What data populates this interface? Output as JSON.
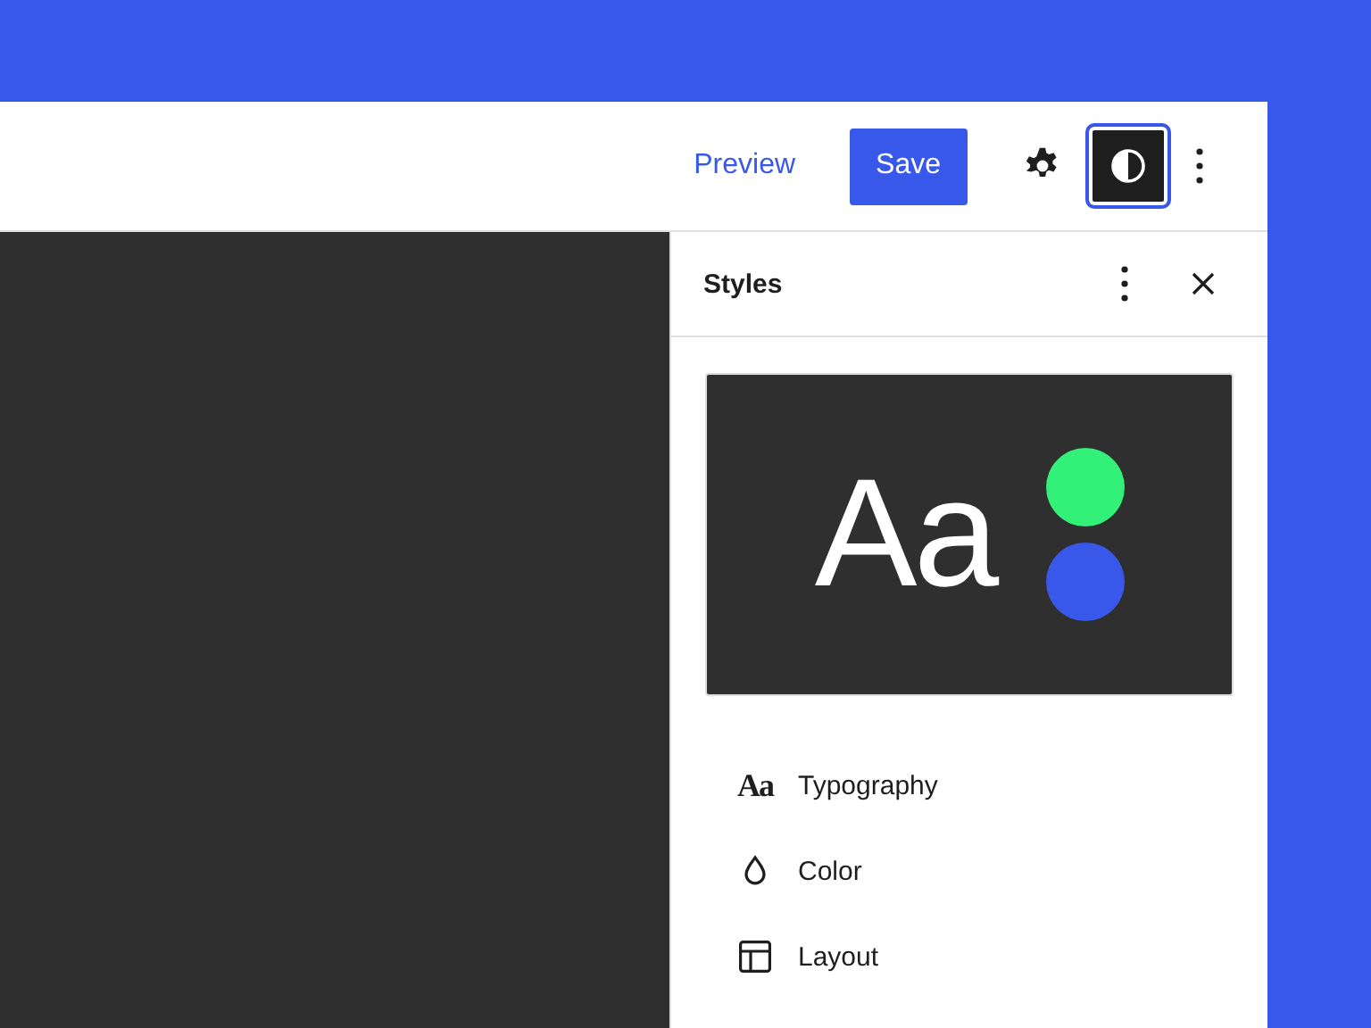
{
  "toolbar": {
    "preview": "Preview",
    "save": "Save",
    "tools": [
      {
        "kind": "settings",
        "selected": false
      },
      {
        "kind": "styles",
        "selected": true
      }
    ]
  },
  "panel": {
    "title": "Styles",
    "preview": {
      "sample": "Aa",
      "dots": [
        {
          "color": "#33f078"
        },
        {
          "color": "#3858e9"
        }
      ]
    },
    "items": [
      {
        "kind": "typography",
        "glyph": "Aa",
        "label": "Typography"
      },
      {
        "kind": "color",
        "label": "Color"
      },
      {
        "kind": "layout",
        "label": "Layout"
      }
    ]
  }
}
